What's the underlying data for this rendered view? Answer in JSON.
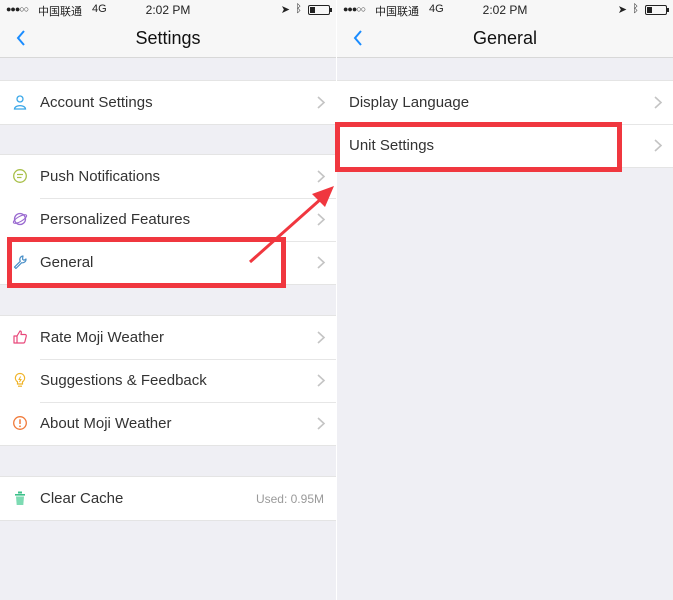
{
  "status_bar": {
    "signal": "●●●○○",
    "carrier": "中国联通",
    "network": "4G",
    "time": "2:02 PM",
    "battery_level": 0.3
  },
  "left_screen": {
    "title": "Settings",
    "groups": [
      {
        "items": [
          {
            "label": "Account Settings",
            "icon": "person-icon"
          }
        ]
      },
      {
        "items": [
          {
            "label": "Push Notifications",
            "icon": "message-icon"
          },
          {
            "label": "Personalized Features",
            "icon": "planet-icon"
          },
          {
            "label": "General",
            "icon": "wrench-icon"
          }
        ]
      },
      {
        "items": [
          {
            "label": "Rate Moji Weather",
            "icon": "thumbs-up-icon"
          },
          {
            "label": "Suggestions & Feedback",
            "icon": "lightbulb-icon"
          },
          {
            "label": "About Moji Weather",
            "icon": "info-icon"
          }
        ]
      },
      {
        "items": [
          {
            "label": "Clear Cache",
            "icon": "trash-icon",
            "extra": "Used:  0.95M"
          }
        ]
      }
    ]
  },
  "right_screen": {
    "title": "General",
    "items": [
      {
        "label": "Display Language"
      },
      {
        "label": "Unit Settings"
      }
    ]
  },
  "colors": {
    "highlight": "#f0373f",
    "accent": "#1a8cff"
  }
}
